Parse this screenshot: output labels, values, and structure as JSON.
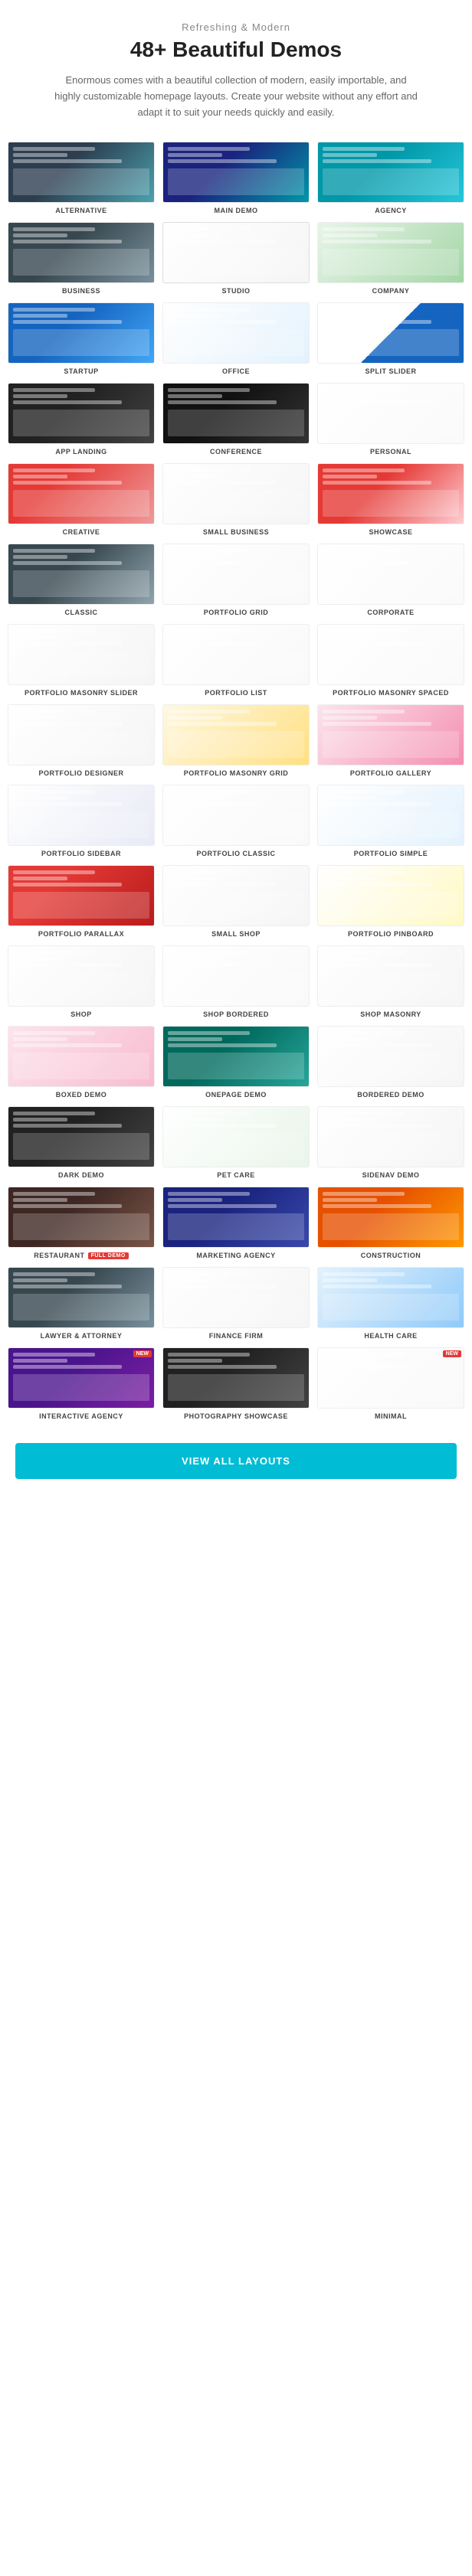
{
  "header": {
    "subtitle": "Refreshing & Modern",
    "title": "48+ Beautiful Demos",
    "description": "Enormous comes with a beautiful collection of modern, easily importable, and highly customizable homepage layouts. Create your website without any effort and adapt it to suit your needs quickly and easily."
  },
  "demos": [
    {
      "id": "alternative",
      "label": "ALTERNATIVE",
      "theme": "t-alt",
      "badge": null
    },
    {
      "id": "main-demo",
      "label": "MAIN DEMO",
      "theme": "t-main",
      "badge": null
    },
    {
      "id": "agency",
      "label": "AGENCY",
      "theme": "t-agency",
      "badge": null
    },
    {
      "id": "business",
      "label": "BUSINESS",
      "theme": "t-biz",
      "badge": null
    },
    {
      "id": "studio",
      "label": "STUDIO",
      "theme": "t-studio",
      "badge": null
    },
    {
      "id": "company",
      "label": "COMPANY",
      "theme": "t-company",
      "badge": null
    },
    {
      "id": "startup",
      "label": "STARTUP",
      "theme": "t-startup",
      "badge": null
    },
    {
      "id": "office",
      "label": "OFFICE",
      "theme": "t-office",
      "badge": null
    },
    {
      "id": "split-slider",
      "label": "SPLIT SLIDER",
      "theme": "t-split",
      "badge": null
    },
    {
      "id": "app-landing",
      "label": "APP LANDING",
      "theme": "t-app",
      "badge": null
    },
    {
      "id": "conference",
      "label": "CONFERENCE",
      "theme": "t-conf",
      "badge": null
    },
    {
      "id": "personal",
      "label": "PERSONAL",
      "theme": "t-personal",
      "badge": null
    },
    {
      "id": "creative",
      "label": "CREATIVE",
      "theme": "t-creative",
      "badge": null
    },
    {
      "id": "small-business",
      "label": "SMALL BUSINESS",
      "theme": "t-smallbiz",
      "badge": null
    },
    {
      "id": "showcase",
      "label": "SHOWCASE",
      "theme": "t-showcase",
      "badge": null
    },
    {
      "id": "classic",
      "label": "CLASSIC",
      "theme": "t-classic",
      "badge": null
    },
    {
      "id": "portfolio-grid",
      "label": "PORTFOLIO GRID",
      "theme": "t-pgrid",
      "badge": null
    },
    {
      "id": "corporate",
      "label": "CORPORATE",
      "theme": "t-corp",
      "badge": null
    },
    {
      "id": "portfolio-masonry-slider",
      "label": "PORTFOLIO MASONRY SLIDER",
      "theme": "t-pmason",
      "badge": null
    },
    {
      "id": "portfolio-list",
      "label": "PORTFOLIO LIST",
      "theme": "t-plist",
      "badge": null
    },
    {
      "id": "portfolio-masonry-spaced",
      "label": "PORTFOLIO MASONRY SPACED",
      "theme": "t-pmasonsp",
      "badge": null
    },
    {
      "id": "portfolio-designer",
      "label": "PORTFOLIO DESIGNER",
      "theme": "t-pdesign",
      "badge": null
    },
    {
      "id": "portfolio-masonry-grid",
      "label": "PORTFOLIO MASONRY GRID",
      "theme": "t-pmasongrid",
      "badge": null
    },
    {
      "id": "portfolio-gallery",
      "label": "PORTFOLIO GALLERY",
      "theme": "t-pgallery",
      "badge": null
    },
    {
      "id": "portfolio-sidebar",
      "label": "PORTFOLIO SIDEBAR",
      "theme": "t-pside",
      "badge": null
    },
    {
      "id": "portfolio-classic",
      "label": "PORTFOLIO CLASSIC",
      "theme": "t-pclass",
      "badge": null
    },
    {
      "id": "portfolio-simple",
      "label": "PORTFOLIO SIMPLE",
      "theme": "t-psimple",
      "badge": null
    },
    {
      "id": "portfolio-parallax",
      "label": "PORTFOLIO PARALLAX",
      "theme": "t-pparallax",
      "badge": null
    },
    {
      "id": "small-shop",
      "label": "SMALL SHOP",
      "theme": "t-smallshop",
      "badge": null
    },
    {
      "id": "portfolio-pinboard",
      "label": "PORTFOLIO PINBOARD",
      "theme": "t-ppin",
      "badge": null
    },
    {
      "id": "shop",
      "label": "SHOP",
      "theme": "t-shop",
      "badge": null
    },
    {
      "id": "shop-bordered",
      "label": "SHOP BORDERED",
      "theme": "t-shopbord",
      "badge": null
    },
    {
      "id": "shop-masonry",
      "label": "SHOP MASONRY",
      "theme": "t-shopmason",
      "badge": null
    },
    {
      "id": "boxed-demo",
      "label": "BOXED DEMO",
      "theme": "t-boxed",
      "badge": null
    },
    {
      "id": "onepage-demo",
      "label": "ONEPAGE DEMO",
      "theme": "t-onepage",
      "badge": null
    },
    {
      "id": "bordered-demo",
      "label": "BORDERED DEMO",
      "theme": "t-bordered",
      "badge": null
    },
    {
      "id": "dark-demo",
      "label": "DARK DEMO",
      "theme": "t-dark",
      "badge": null
    },
    {
      "id": "pet-care",
      "label": "PET CARE",
      "theme": "t-petcare",
      "badge": null
    },
    {
      "id": "sidenav-demo",
      "label": "SIDENAV DEMO",
      "theme": "t-sidenav",
      "badge": null
    },
    {
      "id": "restaurant",
      "label": "RESTAURANT",
      "theme": "t-restaurant",
      "badge": "full",
      "fullDemo": true
    },
    {
      "id": "marketing-agency",
      "label": "MARKETING AGENCY",
      "theme": "t-marketing",
      "badge": null
    },
    {
      "id": "construction",
      "label": "CONSTRUCTION",
      "theme": "t-construction",
      "badge": null
    },
    {
      "id": "lawyer-attorney",
      "label": "LAWYER & ATTORNEY",
      "theme": "t-lawyer",
      "badge": null
    },
    {
      "id": "finance-firm",
      "label": "FINANCE FIRM",
      "theme": "t-finance",
      "badge": null
    },
    {
      "id": "health-care",
      "label": "HEALTH CARE",
      "theme": "t-health",
      "badge": null
    },
    {
      "id": "interactive-agency",
      "label": "INTERACTIVE AGENCY",
      "theme": "t-interactive",
      "badge": "new"
    },
    {
      "id": "photography-showcase",
      "label": "PHOTOGRAPHY SHOWCASE",
      "theme": "t-photo",
      "badge": null
    },
    {
      "id": "minimal",
      "label": "MINIMAL",
      "theme": "t-minimal",
      "badge": "new"
    }
  ],
  "viewAllButton": {
    "label": "VIEW ALL LAYOUTS"
  }
}
